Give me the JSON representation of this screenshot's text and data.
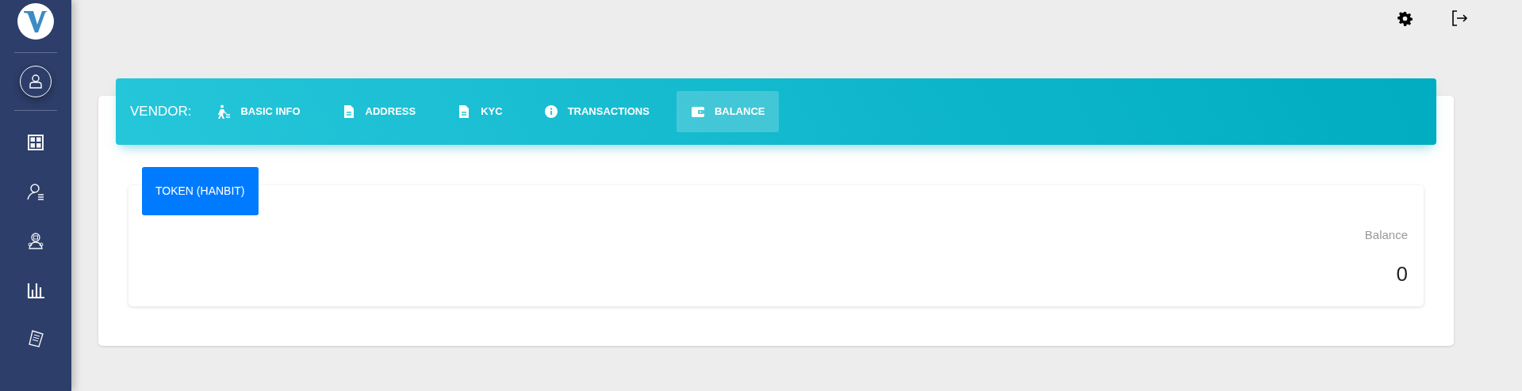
{
  "sidebar": {
    "items": [
      {
        "kind": "dashboard",
        "selected": false
      },
      {
        "kind": "users",
        "selected": false
      },
      {
        "kind": "vendors",
        "selected": false
      },
      {
        "kind": "reports",
        "selected": false
      },
      {
        "kind": "documents",
        "selected": false
      }
    ]
  },
  "tabs": {
    "label": "VENDOR:",
    "items": [
      {
        "label": "BASIC INFO",
        "kind": "person",
        "selected": false
      },
      {
        "label": "ADDRESS",
        "kind": "file",
        "selected": false
      },
      {
        "label": "KYC",
        "kind": "file",
        "selected": false
      },
      {
        "label": "TRANSACTIONS",
        "kind": "info",
        "selected": false
      },
      {
        "label": "BALANCE",
        "kind": "wallet",
        "selected": true
      }
    ]
  },
  "token_tab": {
    "label": "TOKEN (HANBIT)"
  },
  "balance": {
    "label": "Balance",
    "value": "0"
  }
}
